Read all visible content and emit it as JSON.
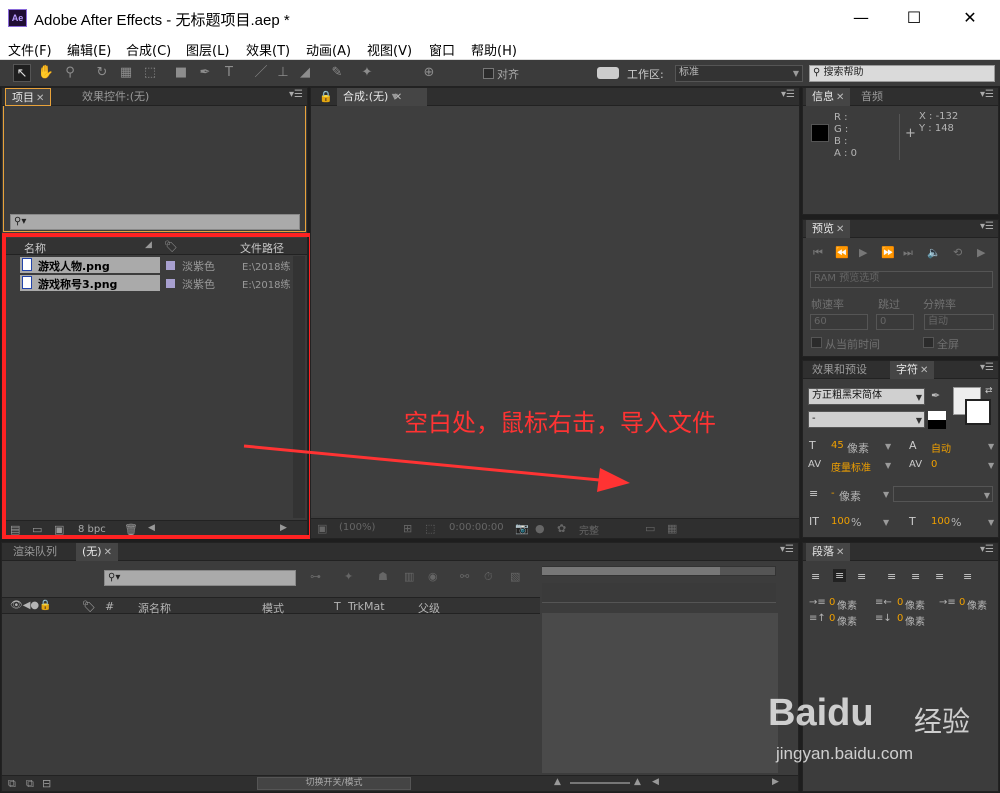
{
  "window": {
    "logo": "Ae",
    "title": "Adobe After Effects - 无标题项目.aep *",
    "minimize": "—",
    "maximize": "☐",
    "close": "✕"
  },
  "menu": [
    "文件(F)",
    "编辑(E)",
    "合成(C)",
    "图层(L)",
    "效果(T)",
    "动画(A)",
    "视图(V)",
    "窗口",
    "帮助(H)"
  ],
  "toolbar": {
    "align_label": "对齐",
    "workspace_label": "工作区:",
    "workspace_value": "标准",
    "search_placeholder": "搜索帮助"
  },
  "project": {
    "tab": "项目",
    "effects_tab": "效果控件:(无)",
    "columns": {
      "name": "名称",
      "path": "文件路径"
    },
    "items": [
      {
        "name": "游戏人物.png",
        "label": "淡紫色",
        "path": "E:\\2018练"
      },
      {
        "name": "游戏称号3.png",
        "label": "淡紫色",
        "path": "E:\\2018练"
      }
    ],
    "bpc": "8 bpc"
  },
  "comp": {
    "tab": "合成:(无)",
    "zoom": "(100%)",
    "timecode": "0:00:00:00",
    "quality": "完整"
  },
  "annotation": "空白处，鼠标右击，导入文件",
  "info": {
    "tab": "信息",
    "audio_tab": "音频",
    "r": "R :",
    "g": "G :",
    "b": "B :",
    "a": "A : 0",
    "x": "X : -132",
    "y": "Y : 148"
  },
  "preview": {
    "tab": "预览",
    "ram": "RAM 预览选项",
    "frame_rate": "帧速率",
    "skip": "跳过",
    "resolution": "分辨率",
    "fr_value": "60",
    "skip_value": "0",
    "res_value": "自动",
    "from_current": "从当前时间",
    "fullscreen": "全屏"
  },
  "character": {
    "effects_tab": "效果和预设",
    "tab": "字符",
    "font": "方正粗黑宋简体",
    "style": "-",
    "size": "45",
    "size_unit": "像素",
    "leading": "自动",
    "kerning": "度量标准",
    "tracking": "0",
    "stroke": "-",
    "stroke_unit": "像素",
    "vscale": "100",
    "hscale": "100",
    "pct": "%"
  },
  "timeline": {
    "render_tab": "渲染队列",
    "comp_tab": "(无)",
    "source_name": "源名称",
    "mode": "模式",
    "t": "T",
    "trkmat": "TrkMat",
    "parent": "父级",
    "hash": "#",
    "toggle": "切换开关/模式"
  },
  "paragraph": {
    "tab": "段落",
    "px": "像素",
    "zero": "0"
  },
  "watermark": {
    "brand": "Baidu",
    "suffix": "经验",
    "url": "jingyan.baidu.com"
  }
}
